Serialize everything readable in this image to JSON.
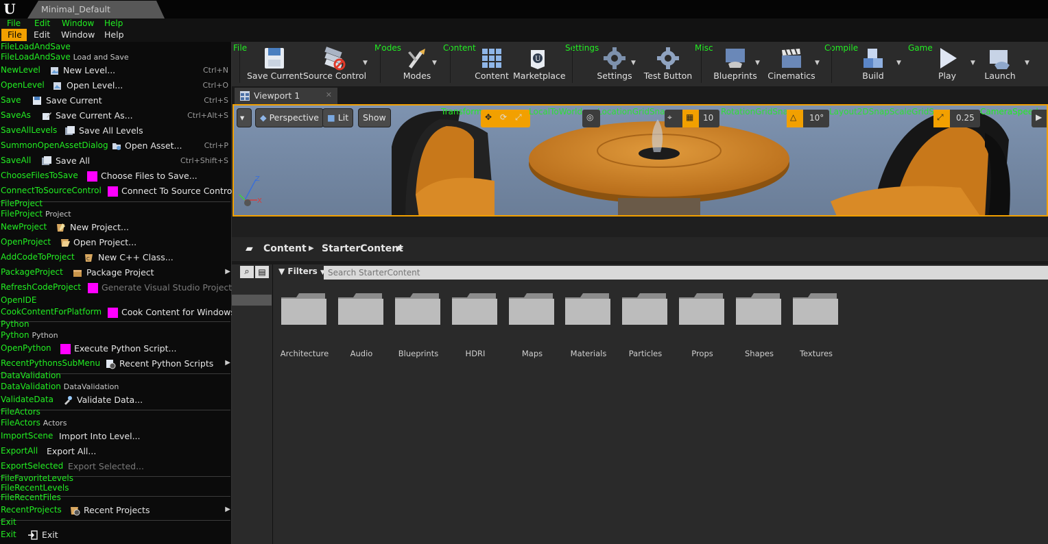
{
  "window": {
    "tab_title": "Minimal_Default",
    "logo": "U"
  },
  "debug_menu_ids": [
    "File",
    "Edit",
    "Window",
    "Help"
  ],
  "menubar": [
    "File",
    "Edit",
    "Window",
    "Help"
  ],
  "file_menu": {
    "sections": [
      {
        "id": "FileLoadAndSave",
        "head_id": "FileLoadAndSave",
        "head_label": "Load and Save"
      },
      {
        "id": "FileProject",
        "head_id": "FileProject",
        "head_label": "Project"
      },
      {
        "id": "Python",
        "head_id": "Python",
        "head_label": "Python"
      },
      {
        "id": "DataValidation",
        "head_id": "DataValidation",
        "head_label": "DataValidation"
      },
      {
        "id": "FileActors",
        "head_id": "FileActors",
        "head_label": "Actors"
      }
    ],
    "items": [
      {
        "id": "NewLevel",
        "label": "New Level...",
        "key": "Ctrl+N"
      },
      {
        "id": "OpenLevel",
        "label": "Open Level...",
        "key": "Ctrl+O"
      },
      {
        "id": "Save",
        "label": "Save Current",
        "key": "Ctrl+S"
      },
      {
        "id": "SaveAs",
        "label": "Save Current As...",
        "key": "Ctrl+Alt+S"
      },
      {
        "id": "SaveAllLevels",
        "label": "Save All Levels",
        "key": ""
      },
      {
        "id": "SummonOpenAssetDialog",
        "label": "Open Asset...",
        "key": "Ctrl+P"
      },
      {
        "id": "SaveAll",
        "label": "Save All",
        "key": "Ctrl+Shift+S"
      },
      {
        "id": "ChooseFilesToSave",
        "label": "Choose Files to Save...",
        "key": ""
      },
      {
        "id": "ConnectToSourceControl",
        "label": "Connect To Source Control...",
        "key": ""
      },
      {
        "id": "NewProject",
        "label": "New Project...",
        "key": ""
      },
      {
        "id": "OpenProject",
        "label": "Open Project...",
        "key": ""
      },
      {
        "id": "AddCodeToProject",
        "label": "New C++ Class...",
        "key": ""
      },
      {
        "id": "PackageProject",
        "label": "Package Project",
        "key": ""
      },
      {
        "id": "RefreshCodeProject",
        "label": "Generate Visual Studio Project",
        "key": ""
      },
      {
        "id": "OpenIDE",
        "label": "",
        "key": ""
      },
      {
        "id": "CookContentForPlatform",
        "label": "Cook Content for Windows",
        "key": ""
      },
      {
        "id": "OpenPython",
        "label": "Execute Python Script...",
        "key": ""
      },
      {
        "id": "RecentPythonsSubMenu",
        "label": "Recent Python Scripts",
        "key": ""
      },
      {
        "id": "ValidateData",
        "label": "Validate Data...",
        "key": ""
      },
      {
        "id": "ImportScene",
        "label": "Import Into Level...",
        "key": ""
      },
      {
        "id": "ExportAll",
        "label": "Export All...",
        "key": ""
      },
      {
        "id": "ExportSelected",
        "label": "Export Selected...",
        "key": ""
      },
      {
        "id": "FileFavoriteLevels",
        "label": "",
        "key": ""
      },
      {
        "id": "FileRecentLevels",
        "label": "",
        "key": ""
      },
      {
        "id": "FileRecentFiles",
        "label": "",
        "key": ""
      },
      {
        "id": "RecentProjects",
        "label": "Recent Projects",
        "key": ""
      },
      {
        "id": "Exit",
        "label": "",
        "key": ""
      },
      {
        "id": "Exit",
        "label": "Exit",
        "key": ""
      }
    ]
  },
  "toolbar": {
    "section_labels": [
      "File",
      "Modes",
      "Content",
      "Settings",
      "Misc",
      "Compile",
      "Game"
    ],
    "buttons": [
      "Save Current",
      "Source Control",
      "Modes",
      "Content",
      "Marketplace",
      "Settings",
      "Test Button",
      "Blueprints",
      "Cinematics",
      "Build",
      "Play",
      "Launch"
    ]
  },
  "viewport": {
    "tab": "Viewport 1",
    "perspective": "Perspective",
    "lit": "Lit",
    "show": "Show",
    "debug_labels": [
      "Transform",
      "LocalToWorld",
      "LocationGridSnap",
      "RotationGridSnap",
      "Layout2DSnapScaleGridSnap",
      "CameraSpeed"
    ],
    "grid_snap": "10",
    "rot_snap": "10°",
    "scale_snap": "0.25",
    "axis_z": "Z",
    "axis_x": "X"
  },
  "content_browser": {
    "path": [
      "Content",
      "StarterContent"
    ],
    "filters": "Filters",
    "search_placeholder": "Search StarterContent",
    "folders": [
      "Architecture",
      "Audio",
      "Blueprints",
      "HDRI",
      "Maps",
      "Materials",
      "Particles",
      "Props",
      "Shapes",
      "Textures"
    ]
  },
  "colors": {
    "accent": "#f2a000",
    "debug_green": "#22ee22",
    "magenta": "#ff00ff"
  }
}
